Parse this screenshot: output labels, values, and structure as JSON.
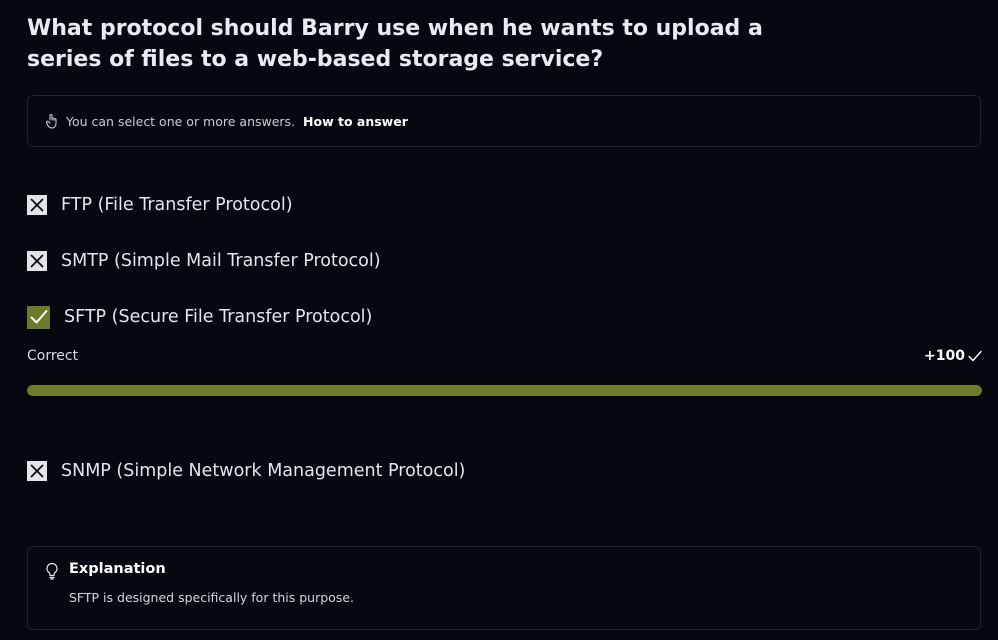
{
  "question": "What protocol should Barry use when he wants to upload a\nseries of files to a web-based storage service?",
  "hint": {
    "text": "You can select one or more answers.",
    "link": "How to answer",
    "icon": "pointer-hand-icon"
  },
  "options": [
    {
      "label": "FTP (File Transfer Protocol)",
      "state": "incorrect",
      "icon": "x-icon"
    },
    {
      "label": "SMTP (Simple Mail Transfer Protocol)",
      "state": "incorrect",
      "icon": "x-icon"
    },
    {
      "label": "SFTP (Secure File Transfer Protocol)",
      "state": "correct",
      "icon": "check-icon"
    },
    {
      "label": "SNMP (Simple Network Management Protocol)",
      "state": "incorrect",
      "icon": "x-icon"
    }
  ],
  "result": {
    "label": "Correct",
    "score": "+100",
    "progress_percent": 100
  },
  "explanation": {
    "title": "Explanation",
    "text": "SFTP is designed specifically for this purpose.",
    "icon": "lightbulb-icon"
  },
  "colors": {
    "background": "#05080f",
    "correct_green": "#6d7a2a",
    "border": "#1f2430"
  }
}
